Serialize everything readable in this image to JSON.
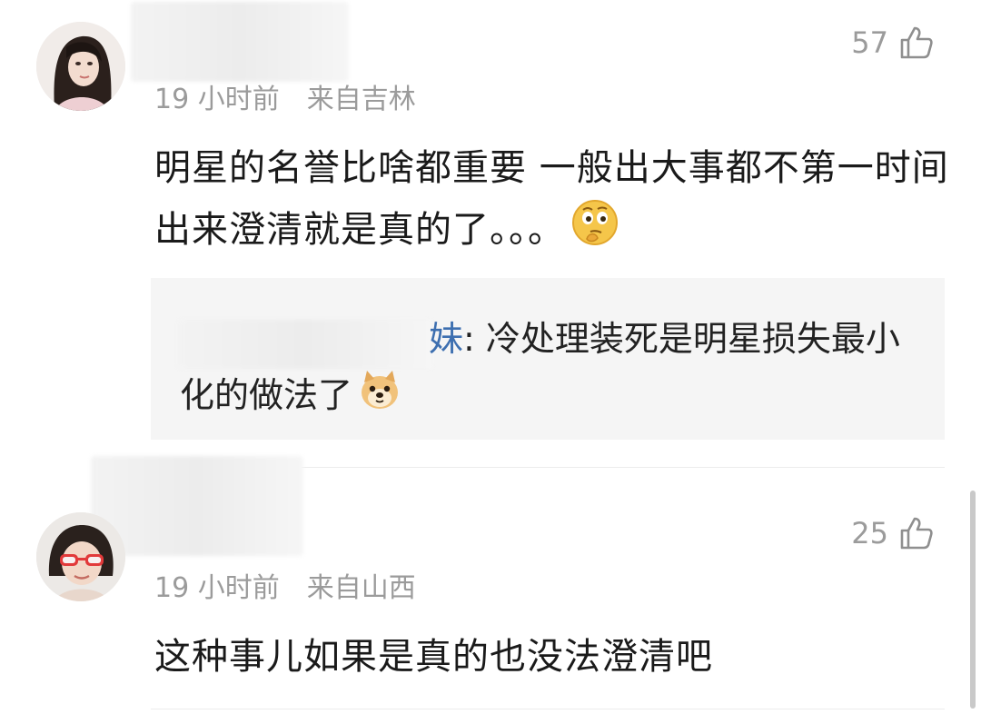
{
  "comments": [
    {
      "time": "19 小时前",
      "location": "来自吉林",
      "likes": "57",
      "text": "明星的名誉比啥都重要 一般出大事都不第一时间出来澄清就是真的了。。。",
      "emoji": "thinking-face",
      "reply": {
        "name_visible": "妹",
        "separator": ": ",
        "text": "冷处理装死是明星损失最小化的做法了",
        "emoji": "doge"
      }
    },
    {
      "time": "19 小时前",
      "location": "来自山西",
      "likes": "25",
      "text": "这种事儿如果是真的也没法澄清吧"
    }
  ],
  "icons": {
    "like": "thumbs-up-icon",
    "avatar1": "avatar-woman-long-hair",
    "avatar2": "avatar-child-red-glasses"
  },
  "colors": {
    "meta": "#9b9b9b",
    "reply_name": "#3d6fb0",
    "reply_bg": "#f5f5f5"
  }
}
